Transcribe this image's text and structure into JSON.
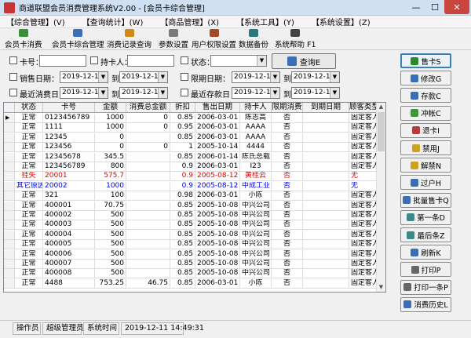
{
  "window": {
    "title": "商道联盟会员消费管理系统V2.00 - [会员卡综合管理]",
    "min": "—",
    "max": "☐",
    "close": "✕"
  },
  "menu": [
    "【综合管理】(V)",
    "【查询统计】(W)",
    "【商品管理】(X)",
    "【系统工具】(Y)",
    "【系统设置】(Z)"
  ],
  "toolbar": [
    "会员卡消费",
    "会员卡综合管理",
    "消费记录查询",
    "参数设置",
    "用户权限设置",
    "数据备份",
    "系统帮助 F1"
  ],
  "filters": {
    "card_label": "卡号：",
    "holder_label": "持卡人：",
    "status_label": "状态：",
    "sale_date_label": "销售日期：",
    "limit_date_label": "限期日期：",
    "last_consume_label": "最近消费日",
    "last_deposit_label": "最近存款日",
    "to": "到",
    "date1": "2019-12-11",
    "date2": "2019-12-11",
    "query_label": "查询E"
  },
  "table": {
    "columns": [
      "状态",
      "卡号",
      "金额",
      "消费总金额",
      "折扣",
      "售出日期",
      "持卡人",
      "限期消费",
      "到期日期",
      "顾客类型"
    ],
    "rows": [
      [
        "正常",
        "0123456789",
        "1000",
        "0",
        "0.85",
        "2006-03-01",
        "陈志高",
        "否",
        "",
        "固定客人"
      ],
      [
        "正常",
        "1111",
        "1000",
        "0",
        "0.95",
        "2006-03-01",
        "AAAA",
        "否",
        "",
        "固定客人"
      ],
      [
        "正常",
        "12345",
        "0",
        "",
        "0.85",
        "2006-03-01",
        "AAAA",
        "否",
        "",
        "固定客人"
      ],
      [
        "正常",
        "123456",
        "0",
        "0",
        "1",
        "2005-10-14",
        "4444",
        "否",
        "",
        "固定客人"
      ],
      [
        "正常",
        "12345678",
        "345.5",
        "",
        "0.85",
        "2006-01-14",
        "陈氏总载",
        "否",
        "",
        "固定客人"
      ],
      [
        "正常",
        "123456789",
        "800",
        "",
        "0.9",
        "2006-03-01",
        "I23",
        "否",
        "",
        "固定客人"
      ],
      [
        "挂失",
        "20001",
        "575.7",
        "",
        "0.9",
        "2005-08-12",
        "黄桂云",
        "否",
        "",
        "无"
      ],
      [
        "其它原因",
        "20002",
        "1000",
        "",
        "0.9",
        "2005-08-12",
        "中成工业",
        "否",
        "",
        "无"
      ],
      [
        "正常",
        "321",
        "100",
        "",
        "0.98",
        "2006-03-01",
        "小陈",
        "否",
        "",
        "固定客人"
      ],
      [
        "正常",
        "400001",
        "70.75",
        "",
        "0.85",
        "2005-10-08",
        "中兴公司",
        "否",
        "",
        "固定客人"
      ],
      [
        "正常",
        "400002",
        "500",
        "",
        "0.85",
        "2005-10-08",
        "中兴公司",
        "否",
        "",
        "固定客人"
      ],
      [
        "正常",
        "400003",
        "500",
        "",
        "0.85",
        "2005-10-08",
        "中兴公司",
        "否",
        "",
        "固定客人"
      ],
      [
        "正常",
        "400004",
        "500",
        "",
        "0.85",
        "2005-10-08",
        "中兴公司",
        "否",
        "",
        "固定客人"
      ],
      [
        "正常",
        "400005",
        "500",
        "",
        "0.85",
        "2005-10-08",
        "中兴公司",
        "否",
        "",
        "固定客人"
      ],
      [
        "正常",
        "400006",
        "500",
        "",
        "0.85",
        "2005-10-08",
        "中兴公司",
        "否",
        "",
        "固定客人"
      ],
      [
        "正常",
        "400007",
        "500",
        "",
        "0.85",
        "2005-10-08",
        "中兴公司",
        "否",
        "",
        "固定客人"
      ],
      [
        "正常",
        "400008",
        "500",
        "",
        "0.85",
        "2005-10-08",
        "中兴公司",
        "否",
        "",
        "固定客人"
      ],
      [
        "正常",
        "4488",
        "753.25",
        "46.75",
        "0.85",
        "2006-03-01",
        "小陈",
        "否",
        "",
        "固定客人"
      ]
    ]
  },
  "side_buttons": [
    "售卡S",
    "修改G",
    "存款C",
    "冲帐C",
    "退卡I",
    "禁用J",
    "解禁N",
    "过户H",
    "批量售卡Q",
    "第一条D",
    "最后条Z",
    "刷新K",
    "打印P",
    "打印一条P",
    "消费历史L"
  ],
  "status": {
    "operator_label": "操作员",
    "operator": "超级管理员",
    "time_label": "系统时间",
    "time": "2019-12-11 14:49:31"
  },
  "colors": {
    "lost": "#e00000",
    "other": "#0000e0",
    "accent": "#3c7fb1"
  }
}
